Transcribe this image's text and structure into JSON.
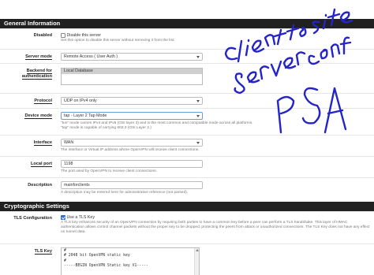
{
  "sections": {
    "general": "General Information",
    "crypto": "Cryptographic Settings"
  },
  "disabled": {
    "label": "Disabled",
    "checkbox_label": "Disable this server",
    "help": "Set this option to disable this server without removing it from the list."
  },
  "server_mode": {
    "label": "Server mode",
    "value": "Remote Access ( User Auth )"
  },
  "backend": {
    "label": "Backend for authentication",
    "value": "Local Database"
  },
  "protocol": {
    "label": "Protocol",
    "value": "UDP on IPv4 only"
  },
  "device_mode": {
    "label": "Device mode",
    "value": "tap - Layer 2 Tap Mode",
    "help1": "\"tun\" mode carries IPv4 and IPv6 (OSI layer 3) and is the most common and compatible mode across all platforms.",
    "help2": "\"tap\" mode is capable of carrying 802.3 (OSI Layer 2.)"
  },
  "interface": {
    "label": "Interface",
    "value": "WAN",
    "help": "The interface or Virtual IP address where OpenVPN will receive client connections."
  },
  "local_port": {
    "label": "Local port",
    "value": "1198",
    "help": "The port used by OpenVPN to receive client connections."
  },
  "description": {
    "label": "Description",
    "value": "mainforclients",
    "help": "A description may be entered here for administrative reference (not parsed)."
  },
  "tls_config": {
    "label": "TLS Configuration",
    "checkbox_label": "Use a TLS Key",
    "help": "A TLS key enhances security of an OpenVPN connection by requiring both parties to have a common key before a peer can perform a TLS handshake. This layer of HMAC authentication allows control channel packets without the proper key to be dropped, protecting the peers from attack or unauthorized connections. The TLS Key does not have any effect on tunnel data."
  },
  "tls_key": {
    "label": "TLS Key",
    "lines": [
      "#",
      "# 2048 bit OpenVPN static key",
      "#",
      "-----BEGIN OpenVPN Static key V1-----"
    ]
  },
  "handwriting": {
    "text": "client to site server conf PSA",
    "color": "#2424c8"
  }
}
